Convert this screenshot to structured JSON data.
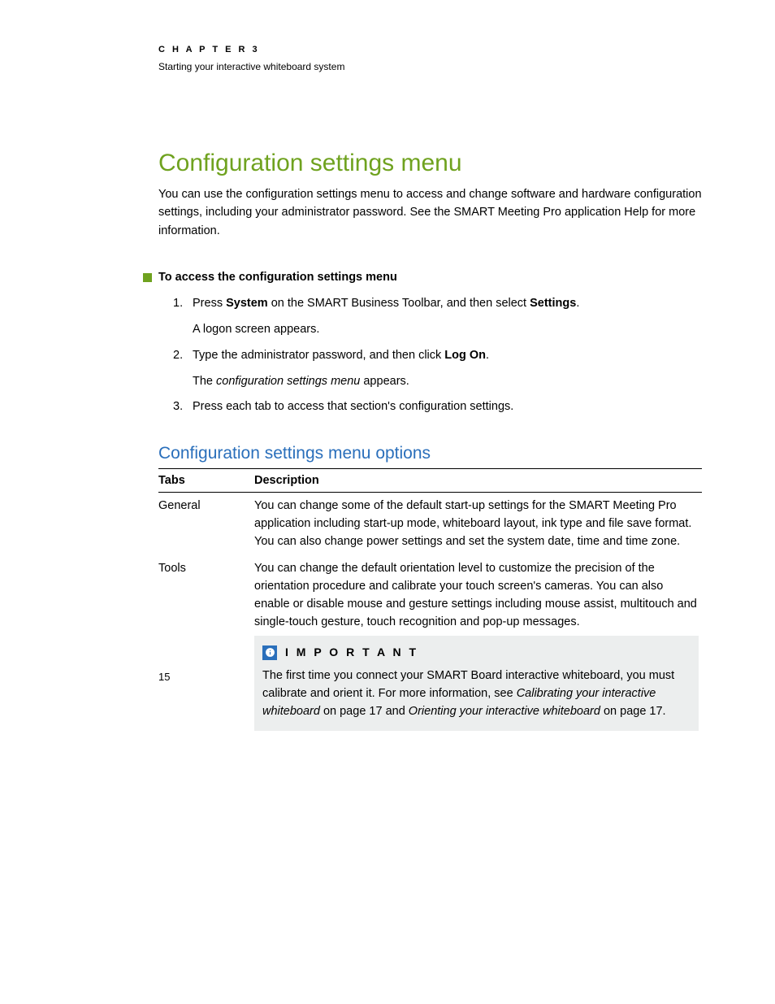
{
  "header": {
    "chapter_label": "C H A P T E R   3",
    "chapter_sub": "Starting your interactive whiteboard system"
  },
  "title": "Configuration settings menu",
  "intro": "You can use the configuration settings menu to access and change software and hardware configuration settings, including your administrator password. See the SMART Meeting Pro application Help for more information.",
  "procedure": {
    "heading": "To access the configuration settings menu",
    "steps": [
      {
        "num": "1.",
        "pre": "Press ",
        "b1": "System",
        "mid": " on the SMART Business Toolbar, and then select ",
        "b2": "Settings",
        "post": ".",
        "sub": "A logon screen appears."
      },
      {
        "num": "2.",
        "pre": "Type the administrator password, and then click ",
        "b1": "Log On",
        "mid": "",
        "b2": "",
        "post": ".",
        "sub_pre": "The ",
        "sub_i": "configuration settings menu",
        "sub_post": " appears."
      },
      {
        "num": "3.",
        "pre": "Press each tab to access that section's configuration settings.",
        "b1": "",
        "mid": "",
        "b2": "",
        "post": ""
      }
    ]
  },
  "subheading": "Configuration settings menu options",
  "table": {
    "col1": "Tabs",
    "col2": "Description",
    "rows": [
      {
        "tab": "General",
        "desc": "You can change some of the default start-up settings for the SMART Meeting Pro application including start-up mode, whiteboard layout, ink type and file save format. You can also change power settings and set the system date, time and time zone."
      },
      {
        "tab": "Tools",
        "desc": "You can change the default orientation level to customize the precision of the orientation procedure and calibrate your touch screen's cameras. You can also enable or disable mouse and gesture settings including mouse assist, multitouch and single-touch gesture, touch recognition and pop-up messages."
      }
    ]
  },
  "important": {
    "label": "I M P O R T A N T",
    "t1": "The first time you connect your SMART Board interactive whiteboard, you must calibrate and orient it. For more information, see ",
    "i1": "Calibrating your interactive whiteboard",
    "t2": " on page 17 and ",
    "i2": "Orienting your interactive whiteboard",
    "t3": " on page 17."
  },
  "page_number": "15"
}
